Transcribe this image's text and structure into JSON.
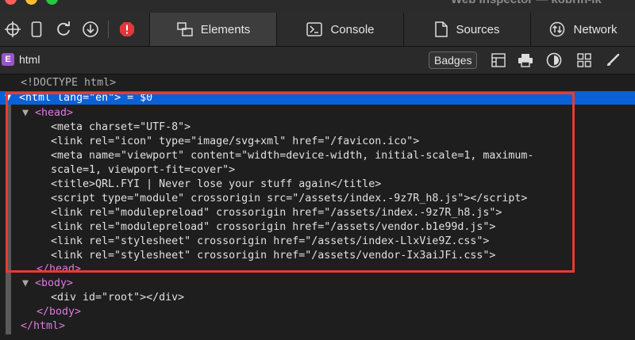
{
  "window": {
    "title": "Web Inspector — kobrin-lk",
    "lights": [
      "#fe5f57",
      "#febc2e",
      "#28c840"
    ]
  },
  "toolbar": {
    "tools": [
      "crosshair-icon",
      "device-icon",
      "reload-icon",
      "download-icon",
      "error-icon"
    ],
    "tabs": [
      {
        "label": "Elements",
        "icon": "elements-icon",
        "active": true
      },
      {
        "label": "Console",
        "icon": "console-icon",
        "active": false
      },
      {
        "label": "Sources",
        "icon": "document-icon",
        "active": false
      },
      {
        "label": "Network",
        "icon": "network-icon",
        "active": false
      }
    ]
  },
  "pathbar": {
    "badge": "E",
    "crumb": "html",
    "badges_label": "Badges",
    "tools": [
      "layout-icon",
      "print-icon",
      "appearance-icon",
      "grid-icon",
      "brush-icon"
    ]
  },
  "dom": {
    "doctype": "<!DOCTYPE html>",
    "html_open": {
      "prefix": "<",
      "name": "html",
      "attr": " lang=",
      "val": "\"en\"",
      "suffix": "> = $0"
    },
    "head_open": "<head>",
    "head_lines": [
      "<meta charset=\"UTF-8\">",
      "<link rel=\"icon\" type=\"image/svg+xml\" href=\"/favicon.ico\">",
      "<meta name=\"viewport\" content=\"width=device-width, initial-scale=1, maximum-",
      "scale=1, viewport-fit=cover\">",
      "<title>QRL.FYI | Never lose your stuff again</title>",
      "<script type=\"module\" crossorigin src=\"/assets/index.-9z7R_h8.js\"></scri​pt>",
      "<link rel=\"modulepreload\" crossorigin href=\"/assets/index.-9z7R_h8.js\">",
      "<link rel=\"modulepreload\" crossorigin href=\"/assets/vendor.b1e99d.js\">",
      "<link rel=\"stylesheet\" crossorigin href=\"/assets/index-LlxVie9Z.css\">",
      "<link rel=\"stylesheet\" crossorigin href=\"/assets/vendor-Ix3aiJFi.css\">"
    ],
    "head_close": "</head>",
    "body_open": "<body>",
    "div_line": "<div id=\"root\"></div>",
    "body_close": "</body>",
    "html_close": "</html>",
    "highlight_color": "#e43d30",
    "selection_color": "#0a61d6"
  }
}
